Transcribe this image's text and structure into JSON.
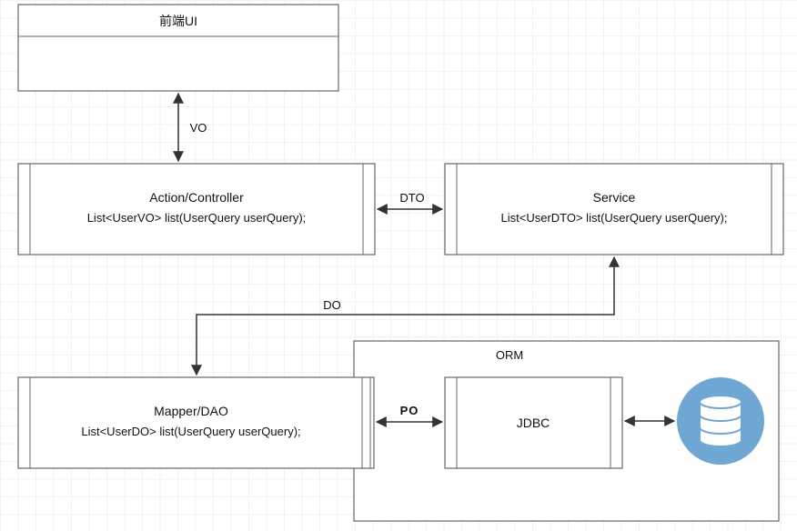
{
  "nodes": {
    "frontend": {
      "title": "前端UI",
      "sub": ""
    },
    "controller": {
      "title": "Action/Controller",
      "sub": "List<UserVO> list(UserQuery userQuery);"
    },
    "service": {
      "title": "Service",
      "sub": "List<UserDTO> list(UserQuery userQuery);"
    },
    "dao": {
      "title": "Mapper/DAO",
      "sub": "List<UserDO> list(UserQuery userQuery);"
    },
    "jdbc": {
      "title": "JDBC",
      "sub": ""
    },
    "orm_frame": {
      "label": "ORM"
    }
  },
  "edges": {
    "vo": {
      "label": "VO"
    },
    "dto": {
      "label": "DTO"
    },
    "do": {
      "label": "DO"
    },
    "po": {
      "label": "PO"
    }
  },
  "icons": {
    "database": "database-icon"
  }
}
